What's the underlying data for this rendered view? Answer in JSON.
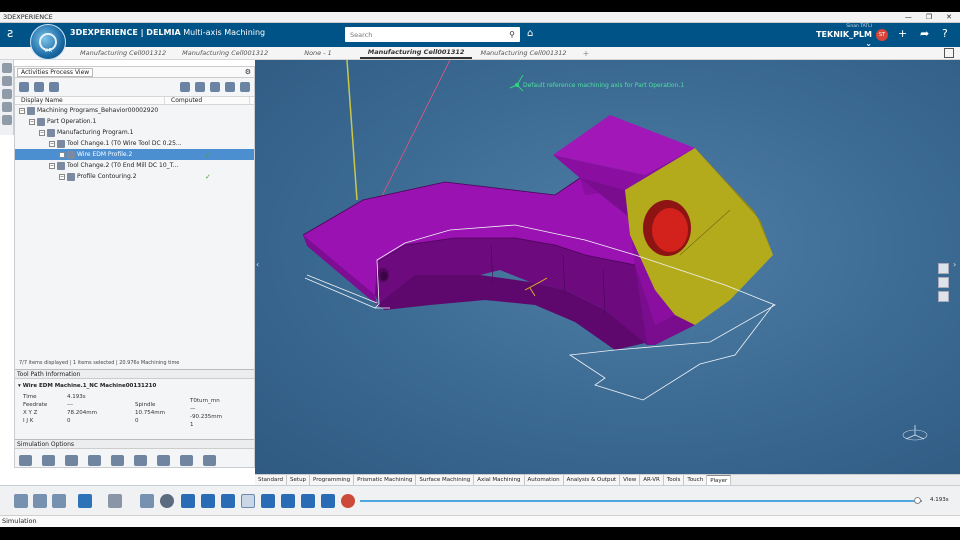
{
  "window": {
    "title": "3DEXPERIENCE",
    "controls": [
      "—",
      "❐",
      "✕"
    ]
  },
  "header": {
    "brand_prefix": "3D",
    "brand_main": "EXPERIENCE | DELMIA",
    "brand_app": "Multi-axis Machining",
    "compass_version": "V.R",
    "search_placeholder": "Search",
    "user_name": "Sinan TATLI",
    "user_role": "TEKNIK_PLM",
    "user_role_arrow": "⌄",
    "badge": "ST"
  },
  "tabs": [
    "Manufacturing Cell001312",
    "Manufacturing Cell001312",
    "None - 1",
    "Manufacturing Cell001312",
    "Manufacturing Cell001312",
    "+"
  ],
  "panel": {
    "title": "Activities Process View",
    "columns": [
      "Display Name",
      "Computed"
    ],
    "tree": [
      {
        "label": "Machining Programs_Behavior00002920",
        "indent": 0,
        "selected": false,
        "computed": ""
      },
      {
        "label": "Part Operation.1",
        "indent": 1,
        "selected": false,
        "computed": ""
      },
      {
        "label": "Manufacturing Program.1",
        "indent": 2,
        "selected": false,
        "computed": ""
      },
      {
        "label": "Tool Change.1 (T0 Wire Tool DC 0.25...",
        "indent": 3,
        "selected": false,
        "computed": ""
      },
      {
        "label": "Wire EDM Profile.2",
        "indent": 4,
        "selected": true,
        "computed": "✓"
      },
      {
        "label": "Tool Change.2 (T0 End Mill DC 10_T...",
        "indent": 3,
        "selected": false,
        "computed": ""
      },
      {
        "label": "Profile Contouring.2",
        "indent": 4,
        "selected": false,
        "computed": "✓"
      }
    ],
    "status": "7/7 items displayed | 1 items selected | 20.976s Machining time"
  },
  "toolpath": {
    "title": "Tool Path Information",
    "machine": "Wire EDM Machine.1_NC Machine00131210",
    "time_label": "Time",
    "time": "4.193s",
    "feedrate_label": "Feedrate",
    "feedrate": "---",
    "spindle_label": "Spindle",
    "spindle": "—",
    "spindle_unit": "T0turn_mn",
    "xyz_label": "X Y Z",
    "x": "78.204mm",
    "y": "10.754mm",
    "z": "-90.235mm",
    "ijk_label": "I J K",
    "i": "0",
    "j": "0",
    "k": "1"
  },
  "simulation": {
    "title": "Simulation Options"
  },
  "viewport": {
    "annotation": "Default reference machining axis for Part Operation.1"
  },
  "workbench_tabs": [
    "Standard",
    "Setup",
    "Programming",
    "Prismatic Machining",
    "Surface Machining",
    "Axial Machining",
    "Automation",
    "Analysis & Output",
    "View",
    "AR-VR",
    "Tools",
    "Touch",
    "Player"
  ],
  "active_workbench": "Player",
  "player": {
    "time": "4.193s",
    "progress": 0.995
  },
  "statusbar": {
    "text": "Simulation"
  },
  "colors": {
    "header": "#005386",
    "part": "#9a10b0",
    "face": "#b9b21e",
    "hole": "#d0201a",
    "viewport": "#3a6991"
  }
}
